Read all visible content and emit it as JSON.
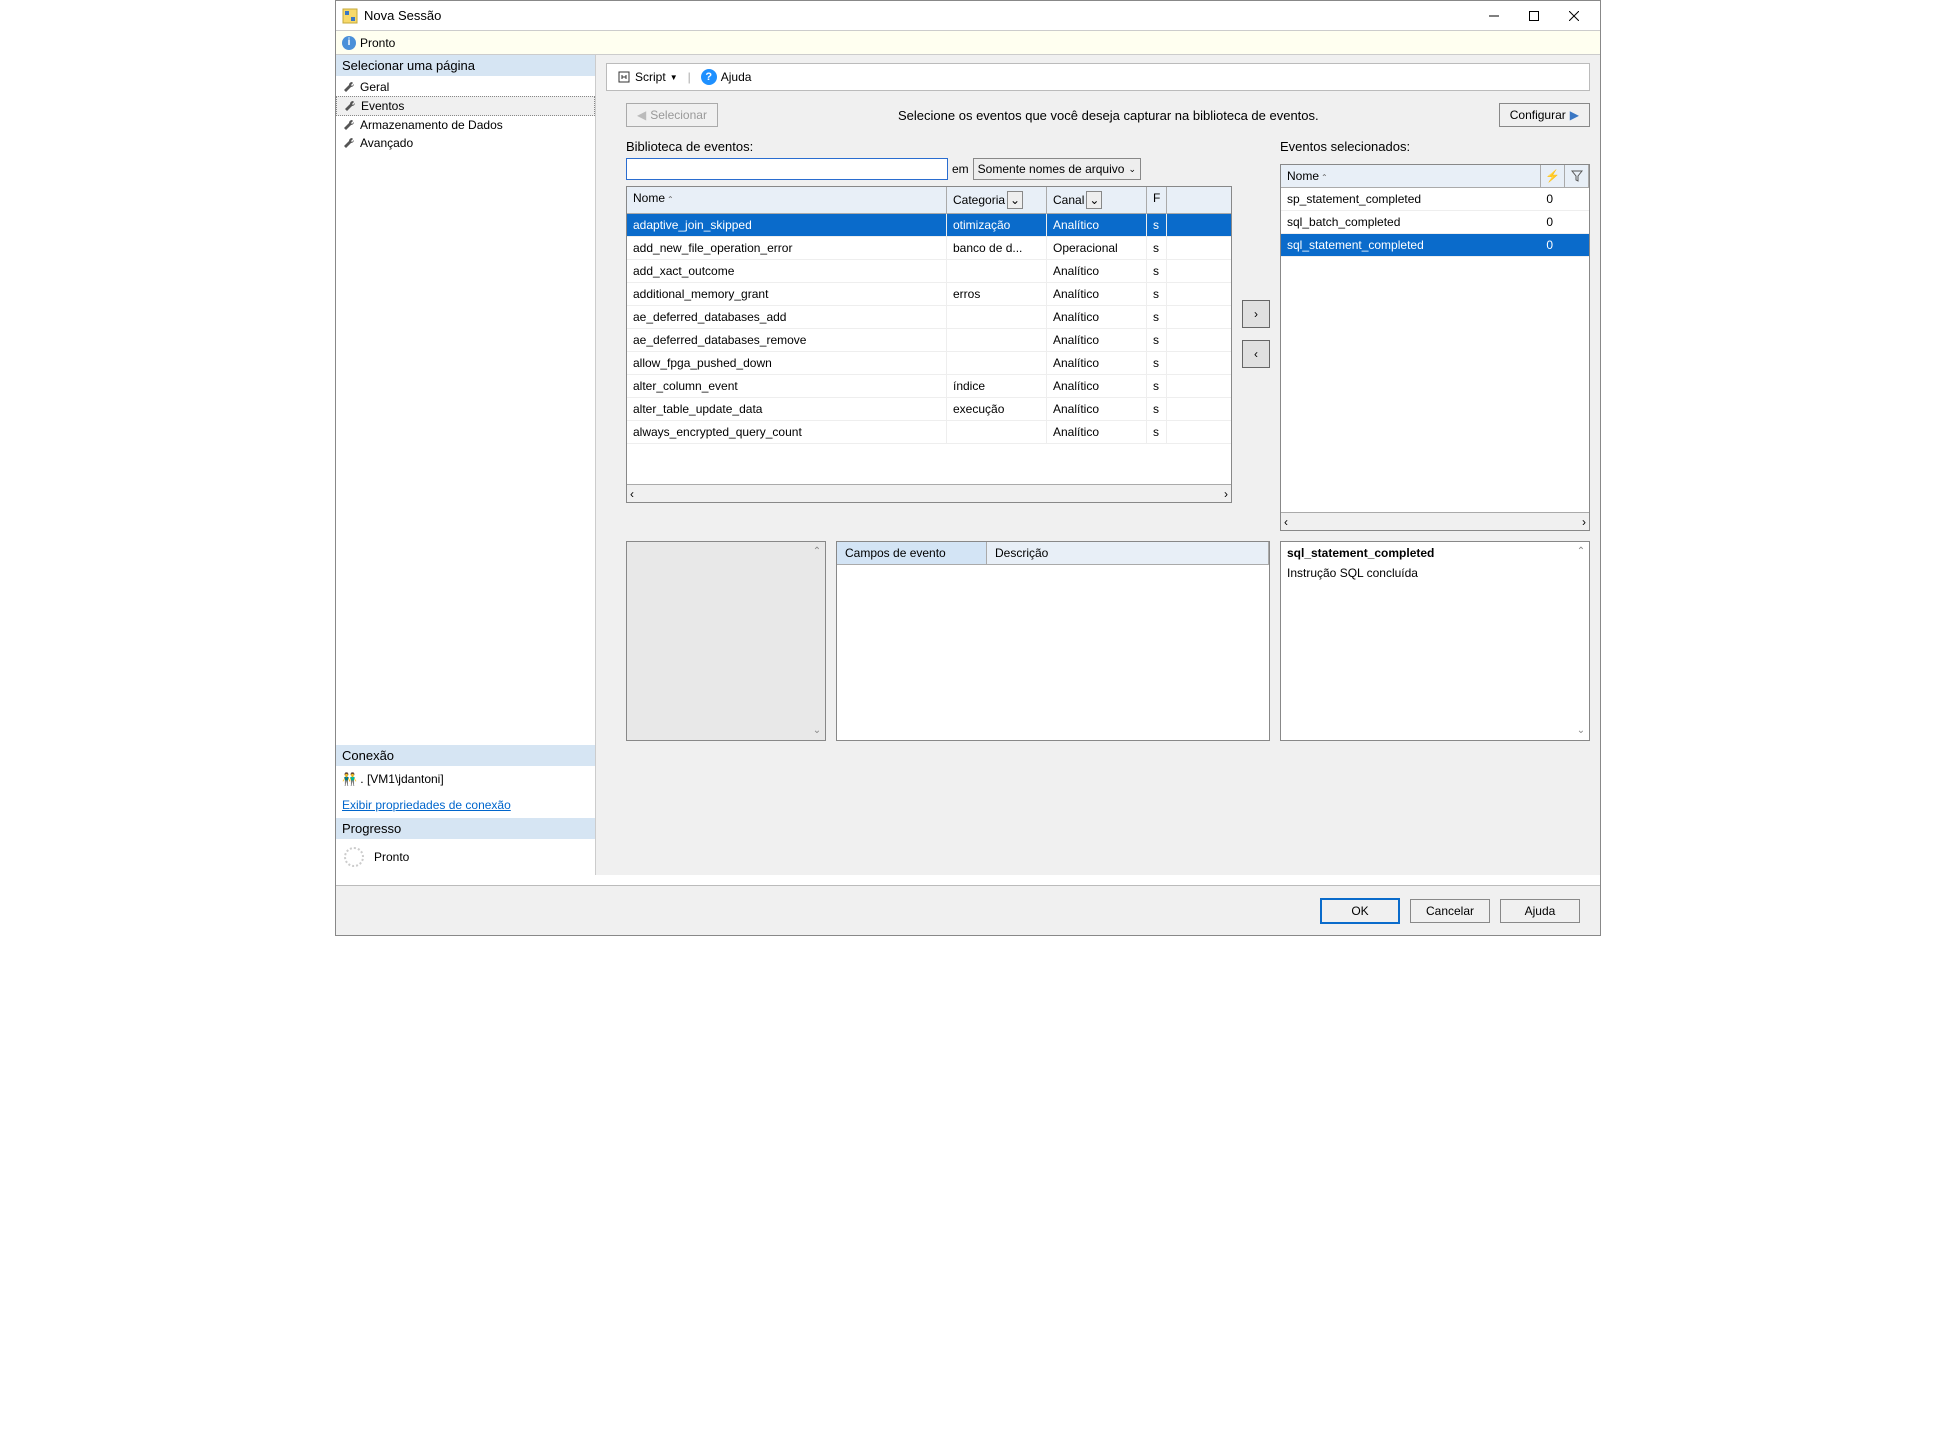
{
  "window": {
    "title": "Nova Sessão"
  },
  "status": {
    "text": "Pronto"
  },
  "sidebar": {
    "header": "Selecionar uma página",
    "items": [
      "Geral",
      "Eventos",
      "Armazenamento de Dados",
      "Avançado"
    ],
    "connection_header": "Conexão",
    "connection": ". [VM1\\jdantoni]",
    "conn_link": "Exibir propriedades de conexão",
    "progress_header": "Progresso",
    "progress_text": "Pronto"
  },
  "toolbar": {
    "script": "Script",
    "help": "Ajuda"
  },
  "toprow": {
    "select_btn": "Selecionar",
    "hint": "Selecione os eventos que você deseja capturar na biblioteca de eventos.",
    "config_btn": "Configurar"
  },
  "library": {
    "label": "Biblioteca de eventos:",
    "in_label": "em",
    "filter_mode": "Somente nomes de arquivo",
    "cols": {
      "name": "Nome",
      "category": "Categoria",
      "channel": "Canal",
      "last": "F"
    },
    "rows": [
      {
        "name": "adaptive_join_skipped",
        "category": "otimização",
        "channel": "Analítico",
        "last": "s",
        "sel": true
      },
      {
        "name": "add_new_file_operation_error",
        "category": "banco de d...",
        "channel": "Operacional",
        "last": "s"
      },
      {
        "name": "add_xact_outcome",
        "category": "",
        "channel": "Analítico",
        "last": "s"
      },
      {
        "name": "additional_memory_grant",
        "category": "erros",
        "channel": "Analítico",
        "last": "s"
      },
      {
        "name": "ae_deferred_databases_add",
        "category": "",
        "channel": "Analítico",
        "last": "s"
      },
      {
        "name": "ae_deferred_databases_remove",
        "category": "",
        "channel": "Analítico",
        "last": "s"
      },
      {
        "name": "allow_fpga_pushed_down",
        "category": "",
        "channel": "Analítico",
        "last": "s"
      },
      {
        "name": "alter_column_event",
        "category": "índice",
        "channel": "Analítico",
        "last": "s"
      },
      {
        "name": "alter_table_update_data",
        "category": "execução",
        "channel": "Analítico",
        "last": "s"
      },
      {
        "name": "always_encrypted_query_count",
        "category": "",
        "channel": "Analítico",
        "last": "s"
      }
    ]
  },
  "selected": {
    "label": "Eventos selecionados:",
    "col_name": "Nome",
    "rows": [
      {
        "name": "sp_statement_completed",
        "val": "0"
      },
      {
        "name": "sql_batch_completed",
        "val": "0"
      },
      {
        "name": "sql_statement_completed",
        "val": "0",
        "sel": true
      }
    ]
  },
  "detail_mid": {
    "c1": "Campos de evento",
    "c2": "Descrição"
  },
  "detail_right": {
    "title": "sql_statement_completed",
    "desc": "Instrução SQL concluída"
  },
  "footer": {
    "ok": "OK",
    "cancel": "Cancelar",
    "help": "Ajuda"
  }
}
